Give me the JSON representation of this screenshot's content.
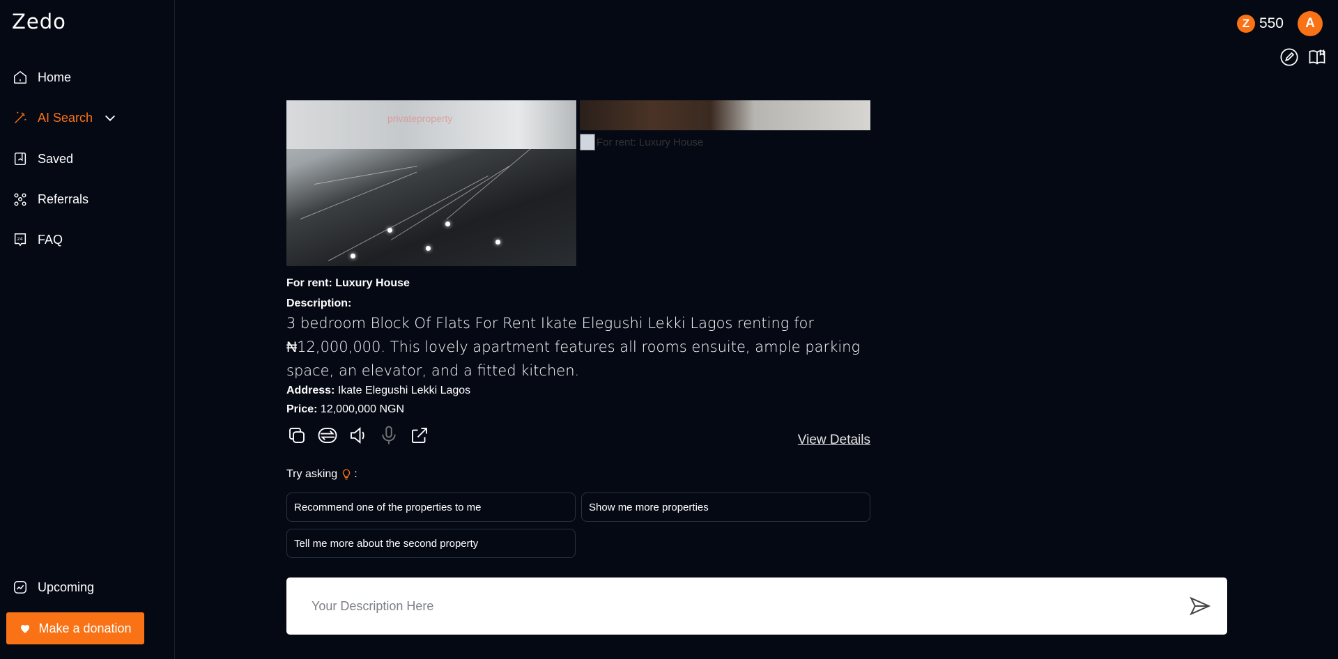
{
  "app": {
    "name": "Zedo"
  },
  "sidebar": {
    "items": [
      {
        "label": "Home",
        "icon": "home-icon"
      },
      {
        "label": "AI Search",
        "icon": "magic-wand-icon",
        "active": true
      },
      {
        "label": "Saved",
        "icon": "bookmark-icon"
      },
      {
        "label": "Referrals",
        "icon": "referrals-icon"
      },
      {
        "label": "FAQ",
        "icon": "faq-icon"
      }
    ],
    "upcoming_label": "Upcoming",
    "donate_label": "Make a donation"
  },
  "header": {
    "credits": "550",
    "avatar_initial": "A"
  },
  "property": {
    "broken_image_alt": "For rent: Luxury House",
    "title": "For rent: Luxury House",
    "description_label": "Description:",
    "description": "3 bedroom Block Of Flats For Rent Ikate Elegushi Lekki Lagos renting for ₦12,000,000. This lovely apartment features all rooms ensuite, ample parking space, an elevator, and a fitted kitchen.",
    "address_label": "Address:",
    "address": "Ikate Elegushi Lekki Lagos",
    "price_label": "Price:",
    "price": "12,000,000 NGN",
    "view_details": "View Details",
    "watermark": "privateproperty"
  },
  "suggestions": {
    "label": "Try asking",
    "items": [
      "Recommend one of the properties to me",
      "Show me more properties",
      "Tell me more about the second property"
    ]
  },
  "input": {
    "placeholder": "Your Description Here"
  },
  "colors": {
    "accent": "#f97316",
    "background": "#050914"
  }
}
